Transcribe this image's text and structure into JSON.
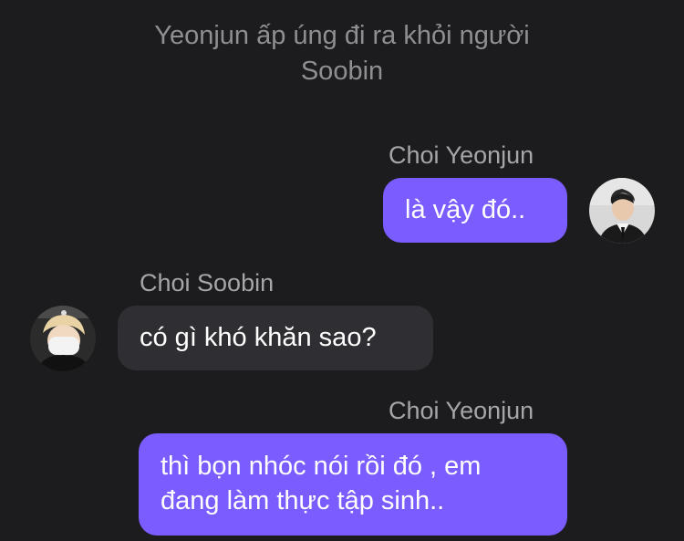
{
  "system_message": "Yeonjun ấp úng đi ra khỏi người Soobin",
  "messages": [
    {
      "sender": "Choi Yeonjun",
      "text": "là vậy đó..",
      "direction": "outgoing",
      "avatar": "yeonjun-avatar"
    },
    {
      "sender": "Choi Soobin",
      "text": "có gì khó khăn sao?",
      "direction": "incoming",
      "avatar": "soobin-avatar"
    },
    {
      "sender": "Choi Yeonjun",
      "text": "thì bọn nhóc nói rồi đó , em đang làm thực tập sinh..",
      "direction": "outgoing"
    }
  ],
  "colors": {
    "background": "#1c1c1e",
    "outgoing_bubble": "#7b5cff",
    "incoming_bubble": "#2f2f33",
    "system_text": "#8e8e93",
    "sender_text": "#a5a5aa"
  }
}
